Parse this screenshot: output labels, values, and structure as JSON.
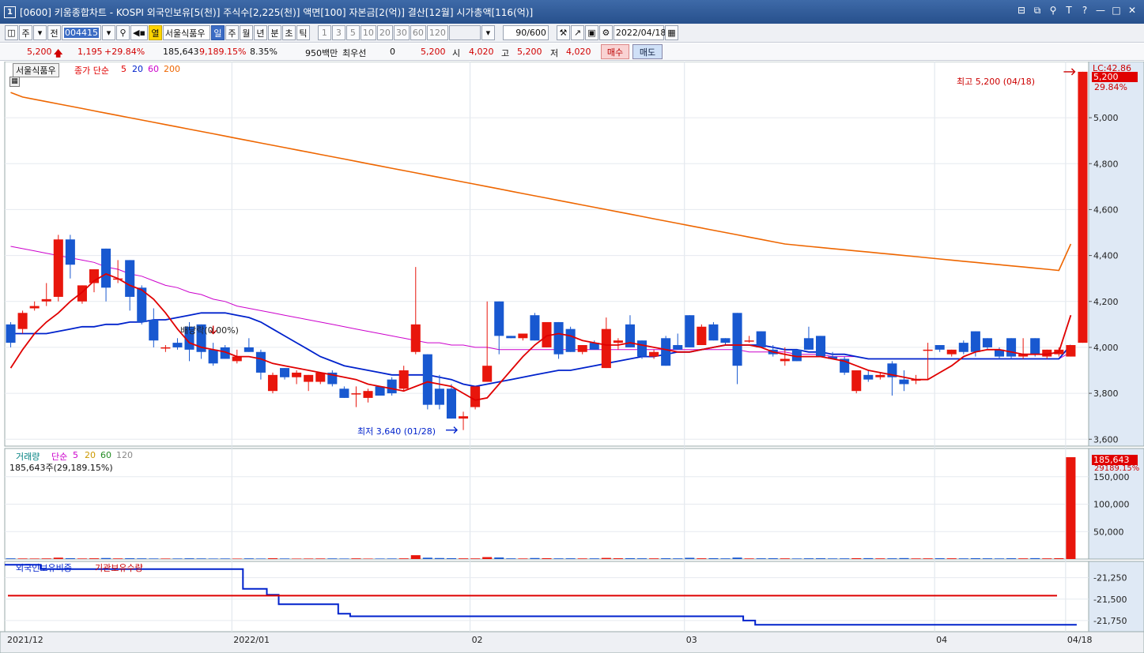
{
  "window": {
    "badge": "1",
    "title": "[0600] 키움종합차트 - KOSPI 외국인보유[5(천)] 주식수[2,225(천)] 액면[100] 자본금[2(억)] 결산[12월] 시가총액[116(억)]"
  },
  "toolbar": {
    "period_main": "주",
    "range": "전",
    "code": "004415",
    "stock_name": "서울식품우",
    "col_label": "열",
    "periods": [
      "일",
      "주",
      "월",
      "년",
      "분",
      "초",
      "틱"
    ],
    "selected_period": "일",
    "minutes": [
      "1",
      "3",
      "5",
      "10",
      "20",
      "30",
      "60",
      "120"
    ],
    "count": "90/600",
    "date": "2022/04/18"
  },
  "quote": {
    "price": "5,200",
    "change": "1,195",
    "change_pct": "+29.84%",
    "volume": "185,643",
    "volume_ratio": "9,189.15%",
    "turnover": "8.35%",
    "trade_value": "950백만",
    "pref_label": "최우선",
    "pref_val": "0",
    "ask": "5,200",
    "open_label": "시",
    "open": "4,020",
    "high_label": "고",
    "high": "5,200",
    "low_label": "저",
    "low": "4,020",
    "buy_label": "매수",
    "sell_label": "매도"
  },
  "legend": {
    "stock": "서울식품우",
    "ma_label": "종가 단순",
    "ma": [
      "5",
      "20",
      "60",
      "200"
    ],
    "colors": {
      "ma5": "#e00000",
      "ma20": "#0022cc",
      "ma60": "#cc00cc",
      "ma200": "#ee6600",
      "up": "#e8160c",
      "down": "#1858d0"
    }
  },
  "vol_legend": {
    "title": "거래량",
    "ma_label": "단순",
    "ma": [
      "5",
      "20",
      "60",
      "120"
    ],
    "summary": "185,643주(29,189.15%)"
  },
  "foreign_legend": {
    "title1": "외국인보유비중",
    "title2": "기관보유수량"
  },
  "annotations": {
    "high": "최고 5,200 (04/18)",
    "low": "최저 3,640 (01/28)",
    "div": "배당락(0.00%)",
    "lc": "LC:42.86",
    "last_price": "5,200",
    "last_pct": "29.84%",
    "last_vol": "185,643",
    "last_vol_pct": "29189.15%"
  },
  "chart_data": {
    "type": "candlestick",
    "price_axis": [
      "5,000",
      "4,800",
      "4,600",
      "4,400",
      "4,200",
      "4,000",
      "3,800",
      "3,600"
    ],
    "price_ticks": [
      5000,
      4800,
      4600,
      4400,
      4200,
      4000,
      3800,
      3600
    ],
    "price_range": [
      3570,
      5210
    ],
    "volume_axis": [
      "150,000",
      "100,000",
      "50,000"
    ],
    "volume_ticks": [
      150000,
      100000,
      50000
    ],
    "volume_range": [
      0,
      190000
    ],
    "foreign_axis": [
      "-21,250",
      "-21,500",
      "-21,750"
    ],
    "foreign_ticks": [
      -21250,
      -21500,
      -21750
    ],
    "foreign_range": [
      -21880,
      -21060
    ],
    "x_labels": [
      {
        "label": "2021/12",
        "i": 0
      },
      {
        "label": "2022/01",
        "i": 19
      },
      {
        "label": "02",
        "i": 39
      },
      {
        "label": "03",
        "i": 57
      },
      {
        "label": "04",
        "i": 78
      },
      {
        "label": "04/18",
        "i": 89
      }
    ],
    "candles": [
      {
        "o": 4100,
        "h": 4110,
        "l": 4000,
        "c": 4020
      },
      {
        "o": 4080,
        "h": 4160,
        "l": 4060,
        "c": 4150
      },
      {
        "o": 4170,
        "h": 4200,
        "l": 4160,
        "c": 4180
      },
      {
        "o": 4200,
        "h": 4280,
        "l": 4180,
        "c": 4210
      },
      {
        "o": 4220,
        "h": 4490,
        "l": 4200,
        "c": 4470
      },
      {
        "o": 4470,
        "h": 4490,
        "l": 4300,
        "c": 4360
      },
      {
        "o": 4200,
        "h": 4270,
        "l": 4190,
        "c": 4270
      },
      {
        "o": 4280,
        "h": 4340,
        "l": 4240,
        "c": 4340
      },
      {
        "o": 4430,
        "h": 4430,
        "l": 4200,
        "c": 4260
      },
      {
        "o": 4300,
        "h": 4380,
        "l": 4280,
        "c": 4300
      },
      {
        "o": 4380,
        "h": 4380,
        "l": 4160,
        "c": 4220
      },
      {
        "o": 4260,
        "h": 4270,
        "l": 4100,
        "c": 4110
      },
      {
        "o": 4120,
        "h": 4170,
        "l": 4000,
        "c": 4030
      },
      {
        "o": 4000,
        "h": 4010,
        "l": 3980,
        "c": 4000
      },
      {
        "o": 4020,
        "h": 4040,
        "l": 3990,
        "c": 4000
      },
      {
        "o": 4090,
        "h": 4110,
        "l": 3940,
        "c": 3990
      },
      {
        "o": 4100,
        "h": 4100,
        "l": 3950,
        "c": 3980
      },
      {
        "o": 3990,
        "h": 4020,
        "l": 3920,
        "c": 3930
      },
      {
        "o": 4000,
        "h": 4010,
        "l": 3950,
        "c": 3950
      },
      {
        "o": 3940,
        "h": 3990,
        "l": 3930,
        "c": 3960
      },
      {
        "o": 4000,
        "h": 4040,
        "l": 3980,
        "c": 3980
      },
      {
        "o": 3980,
        "h": 3990,
        "l": 3860,
        "c": 3890
      },
      {
        "o": 3810,
        "h": 3890,
        "l": 3800,
        "c": 3880
      },
      {
        "o": 3910,
        "h": 3910,
        "l": 3860,
        "c": 3870
      },
      {
        "o": 3870,
        "h": 3900,
        "l": 3840,
        "c": 3890
      },
      {
        "o": 3850,
        "h": 3880,
        "l": 3810,
        "c": 3880
      },
      {
        "o": 3850,
        "h": 3890,
        "l": 3840,
        "c": 3890
      },
      {
        "o": 3890,
        "h": 3900,
        "l": 3830,
        "c": 3840
      },
      {
        "o": 3820,
        "h": 3830,
        "l": 3780,
        "c": 3780
      },
      {
        "o": 3800,
        "h": 3830,
        "l": 3740,
        "c": 3800
      },
      {
        "o": 3780,
        "h": 3820,
        "l": 3760,
        "c": 3810
      },
      {
        "o": 3830,
        "h": 3830,
        "l": 3790,
        "c": 3790
      },
      {
        "o": 3860,
        "h": 3870,
        "l": 3790,
        "c": 3800
      },
      {
        "o": 3820,
        "h": 3920,
        "l": 3810,
        "c": 3900
      },
      {
        "o": 3980,
        "h": 4350,
        "l": 3970,
        "c": 4100
      },
      {
        "o": 3970,
        "h": 3970,
        "l": 3730,
        "c": 3750
      },
      {
        "o": 3820,
        "h": 3880,
        "l": 3730,
        "c": 3750
      },
      {
        "o": 3820,
        "h": 3840,
        "l": 3690,
        "c": 3690
      },
      {
        "o": 3690,
        "h": 3720,
        "l": 3640,
        "c": 3700
      },
      {
        "o": 3740,
        "h": 3800,
        "l": 3730,
        "c": 3830
      },
      {
        "o": 3850,
        "h": 4200,
        "l": 3850,
        "c": 3920
      },
      {
        "o": 4200,
        "h": 4200,
        "l": 3970,
        "c": 4050
      },
      {
        "o": 4050,
        "h": 4050,
        "l": 4040,
        "c": 4040
      },
      {
        "o": 4040,
        "h": 4060,
        "l": 4030,
        "c": 4060
      },
      {
        "o": 4140,
        "h": 4150,
        "l": 4030,
        "c": 4030
      },
      {
        "o": 4000,
        "h": 4110,
        "l": 4000,
        "c": 4110
      },
      {
        "o": 4110,
        "h": 4110,
        "l": 3950,
        "c": 3970
      },
      {
        "o": 4080,
        "h": 4090,
        "l": 3980,
        "c": 3980
      },
      {
        "o": 3980,
        "h": 4010,
        "l": 3970,
        "c": 4010
      },
      {
        "o": 4020,
        "h": 4030,
        "l": 3990,
        "c": 3990
      },
      {
        "o": 3910,
        "h": 4130,
        "l": 3910,
        "c": 4080
      },
      {
        "o": 4020,
        "h": 4040,
        "l": 3990,
        "c": 4030
      },
      {
        "o": 4100,
        "h": 4140,
        "l": 4000,
        "c": 4000
      },
      {
        "o": 4030,
        "h": 4030,
        "l": 3950,
        "c": 3960
      },
      {
        "o": 3960,
        "h": 3990,
        "l": 3950,
        "c": 3980
      },
      {
        "o": 4040,
        "h": 4050,
        "l": 3920,
        "c": 3920
      },
      {
        "o": 4010,
        "h": 4060,
        "l": 3990,
        "c": 3990
      },
      {
        "o": 4140,
        "h": 4140,
        "l": 4000,
        "c": 4000
      },
      {
        "o": 4010,
        "h": 4100,
        "l": 4010,
        "c": 4090
      },
      {
        "o": 4100,
        "h": 4110,
        "l": 4030,
        "c": 4030
      },
      {
        "o": 4040,
        "h": 4040,
        "l": 4010,
        "c": 4020
      },
      {
        "o": 4150,
        "h": 4150,
        "l": 3840,
        "c": 3920
      },
      {
        "o": 4030,
        "h": 4050,
        "l": 4020,
        "c": 4030
      },
      {
        "o": 4070,
        "h": 4070,
        "l": 4000,
        "c": 4000
      },
      {
        "o": 3990,
        "h": 4010,
        "l": 3960,
        "c": 3970
      },
      {
        "o": 3940,
        "h": 4000,
        "l": 3920,
        "c": 3950
      },
      {
        "o": 3990,
        "h": 3990,
        "l": 3940,
        "c": 3940
      },
      {
        "o": 4040,
        "h": 4090,
        "l": 3990,
        "c": 3990
      },
      {
        "o": 4050,
        "h": 4050,
        "l": 3960,
        "c": 3960
      },
      {
        "o": 3960,
        "h": 3980,
        "l": 3950,
        "c": 3950
      },
      {
        "o": 3950,
        "h": 3960,
        "l": 3880,
        "c": 3890
      },
      {
        "o": 3810,
        "h": 3900,
        "l": 3800,
        "c": 3900
      },
      {
        "o": 3880,
        "h": 3900,
        "l": 3850,
        "c": 3860
      },
      {
        "o": 3870,
        "h": 3890,
        "l": 3860,
        "c": 3880
      },
      {
        "o": 3930,
        "h": 3940,
        "l": 3790,
        "c": 3870
      },
      {
        "o": 3860,
        "h": 3900,
        "l": 3810,
        "c": 3840
      },
      {
        "o": 3860,
        "h": 3880,
        "l": 3840,
        "c": 3860
      },
      {
        "o": 3990,
        "h": 4020,
        "l": 3860,
        "c": 3990
      },
      {
        "o": 4010,
        "h": 4010,
        "l": 3980,
        "c": 3990
      },
      {
        "o": 3970,
        "h": 3990,
        "l": 3960,
        "c": 3990
      },
      {
        "o": 4020,
        "h": 4030,
        "l": 3970,
        "c": 3980
      },
      {
        "o": 4070,
        "h": 4070,
        "l": 3960,
        "c": 3980
      },
      {
        "o": 4040,
        "h": 4040,
        "l": 3990,
        "c": 4000
      },
      {
        "o": 3990,
        "h": 4000,
        "l": 3950,
        "c": 3960
      },
      {
        "o": 4040,
        "h": 4040,
        "l": 3950,
        "c": 3960
      },
      {
        "o": 3960,
        "h": 4040,
        "l": 3950,
        "c": 3970
      },
      {
        "o": 4040,
        "h": 4040,
        "l": 3960,
        "c": 3970
      },
      {
        "o": 3960,
        "h": 3990,
        "l": 3950,
        "c": 3990
      },
      {
        "o": 3970,
        "h": 4000,
        "l": 3960,
        "c": 3990
      },
      {
        "o": 3960,
        "h": 4010,
        "l": 3960,
        "c": 4010
      },
      {
        "o": 4020,
        "h": 5200,
        "l": 4020,
        "c": 5200
      }
    ],
    "ma5": [
      3910,
      3990,
      4060,
      4110,
      4150,
      4200,
      4240,
      4290,
      4320,
      4300,
      4270,
      4250,
      4210,
      4150,
      4080,
      4020,
      4000,
      3990,
      3980,
      3960,
      3960,
      3950,
      3930,
      3920,
      3910,
      3900,
      3890,
      3880,
      3870,
      3860,
      3840,
      3830,
      3820,
      3810,
      3830,
      3850,
      3840,
      3830,
      3800,
      3770,
      3780,
      3840,
      3900,
      3960,
      4010,
      4050,
      4060,
      4050,
      4030,
      4020,
      4010,
      4010,
      4020,
      4010,
      4000,
      3990,
      3980,
      3980,
      3990,
      4000,
      4010,
      4010,
      4010,
      4000,
      3980,
      3970,
      3960,
      3960,
      3960,
      3950,
      3940,
      3920,
      3900,
      3890,
      3880,
      3870,
      3860,
      3860,
      3890,
      3920,
      3960,
      3980,
      3990,
      3990,
      3980,
      3970,
      3970,
      3970,
      3980,
      4140
    ],
    "ma20": [
      4060,
      4060,
      4060,
      4060,
      4070,
      4080,
      4090,
      4090,
      4100,
      4100,
      4110,
      4110,
      4120,
      4120,
      4130,
      4140,
      4150,
      4150,
      4150,
      4140,
      4130,
      4110,
      4080,
      4050,
      4020,
      3990,
      3960,
      3940,
      3920,
      3910,
      3900,
      3890,
      3880,
      3880,
      3880,
      3880,
      3870,
      3860,
      3840,
      3830,
      3840,
      3850,
      3860,
      3870,
      3880,
      3890,
      3900,
      3900,
      3910,
      3920,
      3930,
      3940,
      3950,
      3960,
      3960,
      3970,
      3980,
      3980,
      3990,
      4000,
      4010,
      4010,
      4010,
      4010,
      4000,
      3990,
      3990,
      3980,
      3980,
      3970,
      3970,
      3960,
      3950,
      3950,
      3950,
      3950,
      3950,
      3950,
      3950,
      3950,
      3950,
      3950,
      3950,
      3950,
      3950,
      3950,
      3950,
      3950,
      3950,
      4010
    ],
    "ma60": [
      4440,
      4430,
      4420,
      4410,
      4400,
      4390,
      4380,
      4370,
      4350,
      4340,
      4320,
      4310,
      4290,
      4270,
      4260,
      4240,
      4230,
      4210,
      4200,
      4180,
      4170,
      4160,
      4150,
      4140,
      4130,
      4120,
      4110,
      4100,
      4090,
      4080,
      4070,
      4060,
      4050,
      4040,
      4030,
      4020,
      4020,
      4010,
      4010,
      4000,
      4000,
      3990,
      3990,
      3990,
      3990,
      3990,
      3990,
      3990,
      3990,
      3990,
      3990,
      3990,
      3990,
      3990,
      3990,
      3990,
      3990,
      3990,
      3990,
      3990,
      3990,
      3990,
      3980,
      3980,
      3980,
      3980,
      3970,
      3970,
      3970,
      3960,
      3960,
      3960,
      3950,
      3950,
      3950,
      3950,
      3950,
      3950,
      3950,
      3950,
      3950,
      3950,
      3950,
      3950,
      3950,
      3950,
      3950,
      3950,
      3950,
      3980
    ],
    "ma200": [
      5110,
      5090,
      5080,
      5070,
      5060,
      5050,
      5040,
      5030,
      5020,
      5010,
      5000,
      4990,
      4980,
      4970,
      4960,
      4950,
      4940,
      4930,
      4920,
      4910,
      4900,
      4890,
      4880,
      4870,
      4860,
      4850,
      4840,
      4830,
      4820,
      4810,
      4800,
      4790,
      4780,
      4770,
      4760,
      4750,
      4740,
      4730,
      4720,
      4710,
      4700,
      4690,
      4680,
      4670,
      4660,
      4650,
      4640,
      4630,
      4620,
      4610,
      4600,
      4590,
      4580,
      4570,
      4560,
      4550,
      4540,
      4530,
      4520,
      4510,
      4500,
      4490,
      4480,
      4470,
      4460,
      4450,
      4445,
      4440,
      4435,
      4430,
      4425,
      4420,
      4415,
      4410,
      4405,
      4400,
      4395,
      4390,
      4385,
      4380,
      4375,
      4370,
      4365,
      4360,
      4355,
      4350,
      4345,
      4340,
      4335,
      4450
    ],
    "volume": [
      1200,
      1000,
      900,
      1100,
      2500,
      1500,
      1000,
      1300,
      1800,
      1100,
      1400,
      1200,
      1000,
      900,
      1000,
      1300,
      1100,
      900,
      1000,
      800,
      1200,
      900,
      1400,
      1000,
      800,
      900,
      1000,
      1100,
      900,
      1200,
      800,
      900,
      1000,
      1200,
      7000,
      2400,
      1800,
      1500,
      1200,
      1100,
      3500,
      2800,
      1200,
      1000,
      1800,
      1500,
      1200,
      1300,
      1100,
      1200,
      2000,
      1400,
      1500,
      1300,
      1200,
      1400,
      1200,
      2200,
      1300,
      1500,
      1200,
      2600,
      1100,
      1300,
      1400,
      1200,
      1000,
      1300,
      1400,
      1100,
      1200,
      1500,
      1600,
      1200,
      1300,
      1700,
      1100,
      1200,
      1400,
      1300,
      1200,
      1500,
      1300,
      1100,
      1400,
      1200,
      1600,
      1200,
      1500,
      185643
    ],
    "foreign": [
      -21100,
      -21100,
      -21100,
      -21150,
      -21150,
      -21150,
      -21150,
      -21150,
      -21150,
      -21150,
      -21150,
      -21150,
      -21150,
      -21150,
      -21150,
      -21150,
      -21150,
      -21150,
      -21150,
      -21150,
      -21380,
      -21380,
      -21450,
      -21560,
      -21560,
      -21560,
      -21560,
      -21560,
      -21670,
      -21700,
      -21700,
      -21700,
      -21700,
      -21700,
      -21700,
      -21700,
      -21700,
      -21700,
      -21700,
      -21700,
      -21700,
      -21700,
      -21700,
      -21700,
      -21700,
      -21700,
      -21700,
      -21700,
      -21700,
      -21700,
      -21700,
      -21700,
      -21700,
      -21700,
      -21700,
      -21700,
      -21700,
      -21700,
      -21700,
      -21700,
      -21700,
      -21700,
      -21750,
      -21800,
      -21800,
      -21800,
      -21800,
      -21800,
      -21800,
      -21800,
      -21800,
      -21800,
      -21800,
      -21800,
      -21800,
      -21800,
      -21800,
      -21800,
      -21800,
      -21800,
      -21800,
      -21800,
      -21800,
      -21800,
      -21800,
      -21800,
      -21800,
      -21800,
      -21800,
      -21800
    ],
    "institution": [
      -21460
    ]
  }
}
